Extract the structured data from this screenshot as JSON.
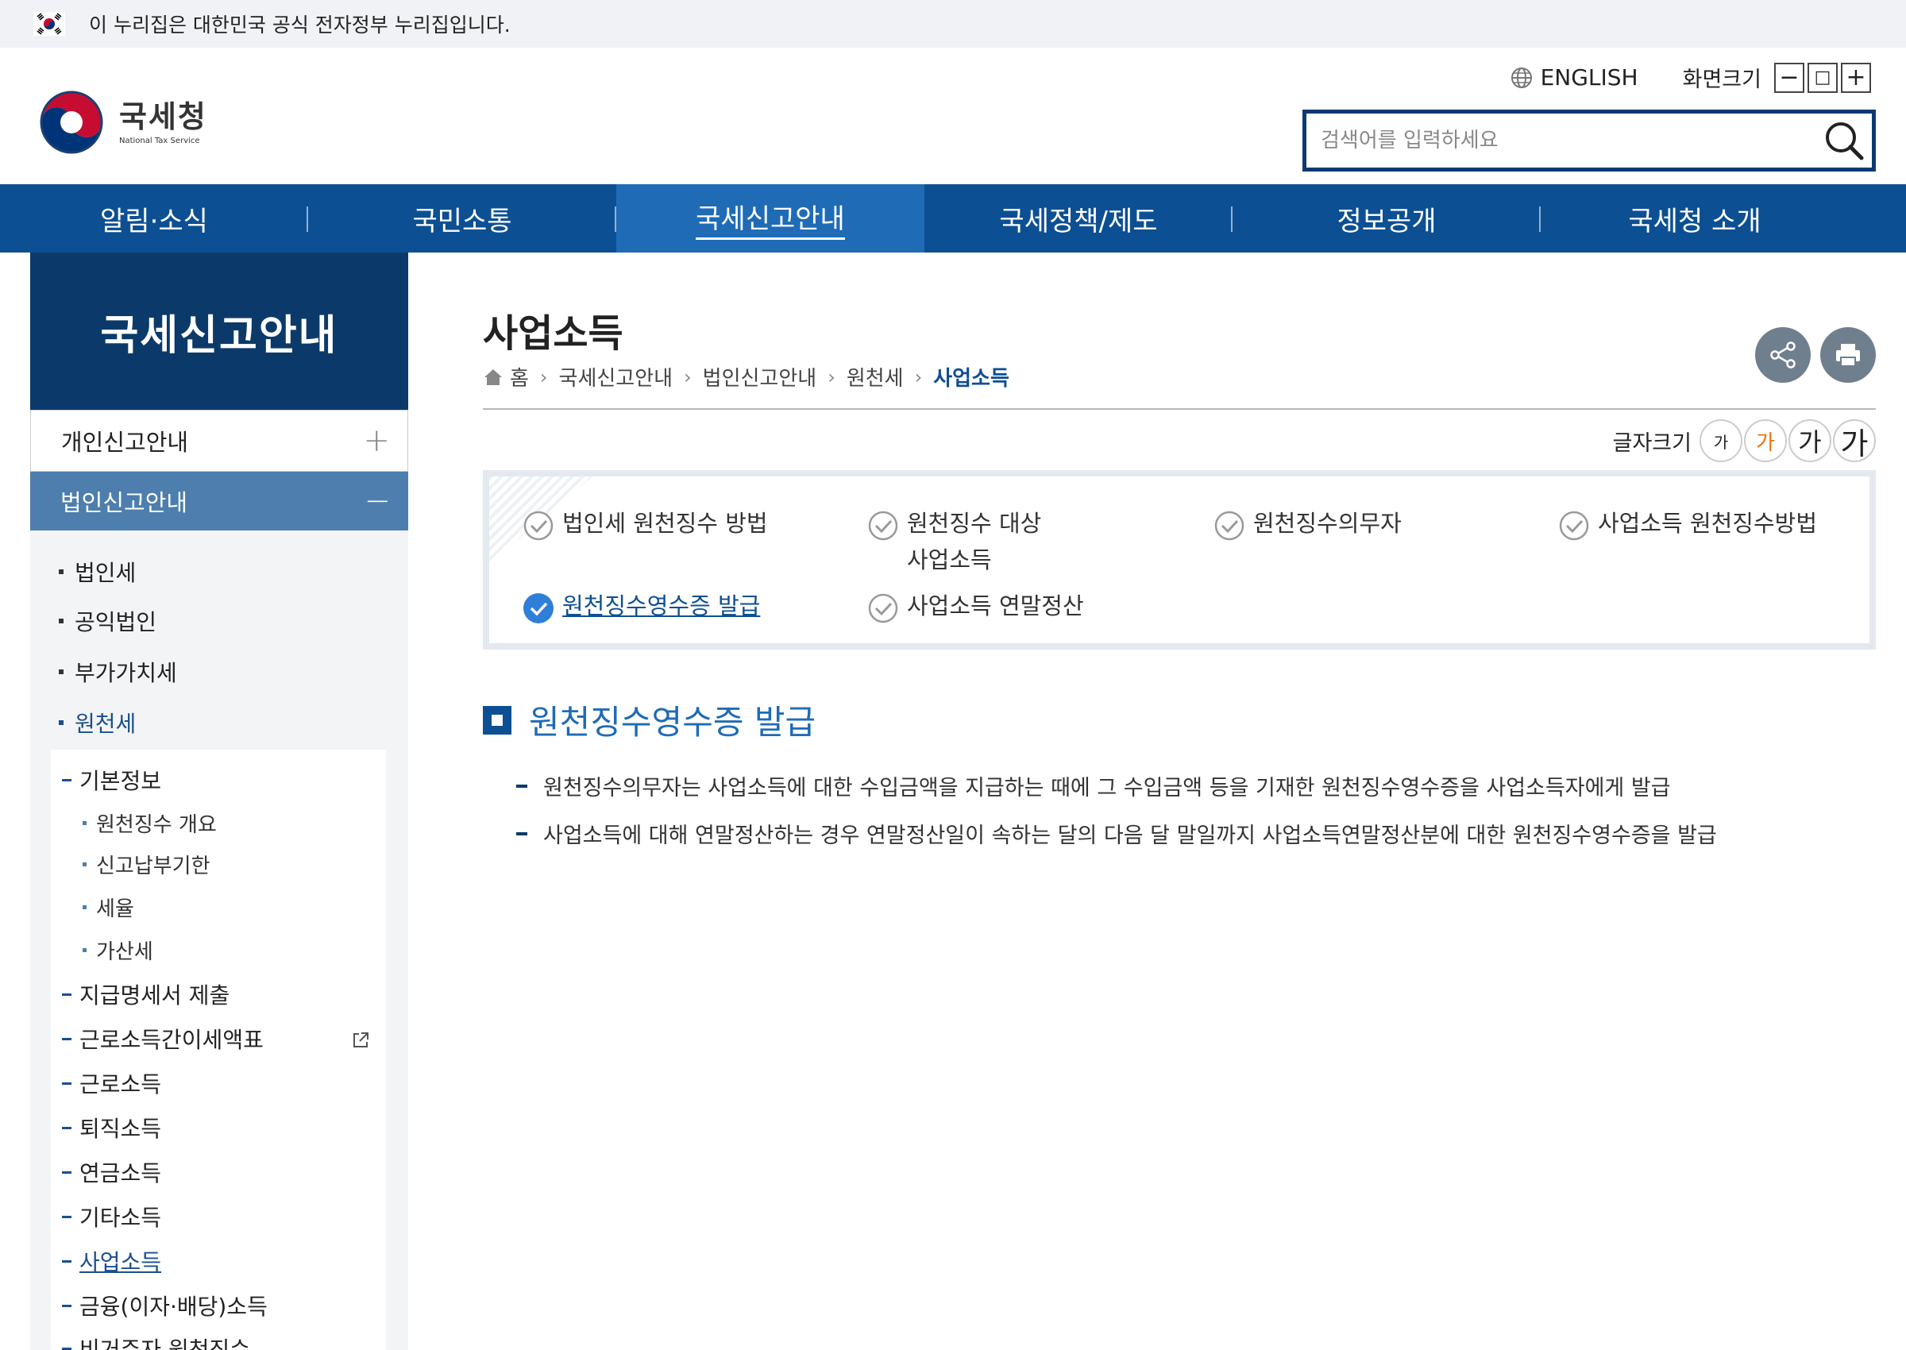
{
  "gov_banner": {
    "text": "이 누리집은 대한민국 공식 전자정부 누리집입니다."
  },
  "logo": {
    "name_ko": "국세청",
    "name_en": "National Tax Service"
  },
  "utility": {
    "language": "ENGLISH",
    "zoom_label": "화면크기",
    "zoom_out": "−",
    "zoom_reset": "□",
    "zoom_in": "+"
  },
  "search": {
    "placeholder": "검색어를 입력하세요",
    "value": ""
  },
  "gnb": [
    {
      "label": "알림·소식",
      "active": false
    },
    {
      "label": "국민소통",
      "active": false
    },
    {
      "label": "국세신고안내",
      "active": true
    },
    {
      "label": "국세정책/제도",
      "active": false
    },
    {
      "label": "정보공개",
      "active": false
    },
    {
      "label": "국세청 소개",
      "active": false
    }
  ],
  "sidebar": {
    "title": "국세신고안내",
    "menu1": {
      "label": "개인신고안내",
      "toggle": "+"
    },
    "menu2": {
      "label": "법인신고안내",
      "toggle": "−"
    },
    "level2": [
      "법인세",
      "공익법인",
      "부가가치세",
      "원천세"
    ],
    "level3_first": "기본정보",
    "level4": [
      "원천징수 개요",
      "신고납부기한",
      "세율",
      "가산세"
    ],
    "level3": [
      "지급명세서 제출",
      "근로소득간이세액표",
      "근로소득",
      "퇴직소득",
      "연금소득",
      "기타소득",
      "사업소득",
      "금융(이자·배당)소득",
      "비거주자 원천징수"
    ]
  },
  "content": {
    "title": "사업소득",
    "breadcrumb": [
      "홈",
      "국세신고안내",
      "법인신고안내",
      "원천세",
      "사업소득"
    ],
    "font_size_label": "글자크기",
    "font_sizes": [
      "가",
      "가",
      "가",
      "가"
    ],
    "tabs": [
      "법인세 원천징수 방법",
      "원천징수 대상",
      "사업소득",
      "원천징수의무자",
      "사업소득 원천징수방법",
      "원천징수영수증 발급",
      "사업소득 연말정산"
    ],
    "section_title": "원천징수영수증 발급",
    "bullets": [
      "원천징수의무자는 사업소득에 대한 수입금액을 지급하는 때에 그 수입금액 등을 기재한 원천징수영수증을 사업소득자에게 발급",
      "사업소득에 대해 연말정산하는 경우 연말정산일이 속하는 달의 다음 달 말일까지 사업소득연말정산분에 대한 원천징수영수증을 발급"
    ]
  },
  "colors": {
    "primary": "#0d4f93",
    "active_tab": "#1f6bb6",
    "side_title": "#0b3a6a",
    "side_active": "#4d7ead",
    "font_active": "#e8730c"
  }
}
